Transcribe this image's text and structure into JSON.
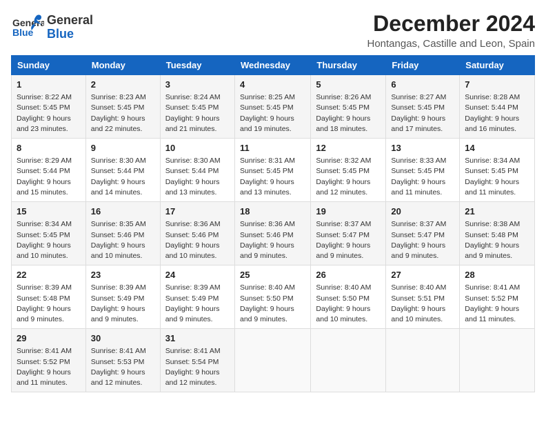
{
  "header": {
    "logo_line1": "General",
    "logo_line2": "Blue",
    "title": "December 2024",
    "subtitle": "Hontangas, Castille and Leon, Spain"
  },
  "days_of_week": [
    "Sunday",
    "Monday",
    "Tuesday",
    "Wednesday",
    "Thursday",
    "Friday",
    "Saturday"
  ],
  "weeks": [
    [
      {
        "day": "1",
        "info": "Sunrise: 8:22 AM\nSunset: 5:45 PM\nDaylight: 9 hours\nand 23 minutes."
      },
      {
        "day": "2",
        "info": "Sunrise: 8:23 AM\nSunset: 5:45 PM\nDaylight: 9 hours\nand 22 minutes."
      },
      {
        "day": "3",
        "info": "Sunrise: 8:24 AM\nSunset: 5:45 PM\nDaylight: 9 hours\nand 21 minutes."
      },
      {
        "day": "4",
        "info": "Sunrise: 8:25 AM\nSunset: 5:45 PM\nDaylight: 9 hours\nand 19 minutes."
      },
      {
        "day": "5",
        "info": "Sunrise: 8:26 AM\nSunset: 5:45 PM\nDaylight: 9 hours\nand 18 minutes."
      },
      {
        "day": "6",
        "info": "Sunrise: 8:27 AM\nSunset: 5:45 PM\nDaylight: 9 hours\nand 17 minutes."
      },
      {
        "day": "7",
        "info": "Sunrise: 8:28 AM\nSunset: 5:44 PM\nDaylight: 9 hours\nand 16 minutes."
      }
    ],
    [
      {
        "day": "8",
        "info": "Sunrise: 8:29 AM\nSunset: 5:44 PM\nDaylight: 9 hours\nand 15 minutes."
      },
      {
        "day": "9",
        "info": "Sunrise: 8:30 AM\nSunset: 5:44 PM\nDaylight: 9 hours\nand 14 minutes."
      },
      {
        "day": "10",
        "info": "Sunrise: 8:30 AM\nSunset: 5:44 PM\nDaylight: 9 hours\nand 13 minutes."
      },
      {
        "day": "11",
        "info": "Sunrise: 8:31 AM\nSunset: 5:45 PM\nDaylight: 9 hours\nand 13 minutes."
      },
      {
        "day": "12",
        "info": "Sunrise: 8:32 AM\nSunset: 5:45 PM\nDaylight: 9 hours\nand 12 minutes."
      },
      {
        "day": "13",
        "info": "Sunrise: 8:33 AM\nSunset: 5:45 PM\nDaylight: 9 hours\nand 11 minutes."
      },
      {
        "day": "14",
        "info": "Sunrise: 8:34 AM\nSunset: 5:45 PM\nDaylight: 9 hours\nand 11 minutes."
      }
    ],
    [
      {
        "day": "15",
        "info": "Sunrise: 8:34 AM\nSunset: 5:45 PM\nDaylight: 9 hours\nand 10 minutes."
      },
      {
        "day": "16",
        "info": "Sunrise: 8:35 AM\nSunset: 5:46 PM\nDaylight: 9 hours\nand 10 minutes."
      },
      {
        "day": "17",
        "info": "Sunrise: 8:36 AM\nSunset: 5:46 PM\nDaylight: 9 hours\nand 10 minutes."
      },
      {
        "day": "18",
        "info": "Sunrise: 8:36 AM\nSunset: 5:46 PM\nDaylight: 9 hours\nand 9 minutes."
      },
      {
        "day": "19",
        "info": "Sunrise: 8:37 AM\nSunset: 5:47 PM\nDaylight: 9 hours\nand 9 minutes."
      },
      {
        "day": "20",
        "info": "Sunrise: 8:37 AM\nSunset: 5:47 PM\nDaylight: 9 hours\nand 9 minutes."
      },
      {
        "day": "21",
        "info": "Sunrise: 8:38 AM\nSunset: 5:48 PM\nDaylight: 9 hours\nand 9 minutes."
      }
    ],
    [
      {
        "day": "22",
        "info": "Sunrise: 8:39 AM\nSunset: 5:48 PM\nDaylight: 9 hours\nand 9 minutes."
      },
      {
        "day": "23",
        "info": "Sunrise: 8:39 AM\nSunset: 5:49 PM\nDaylight: 9 hours\nand 9 minutes."
      },
      {
        "day": "24",
        "info": "Sunrise: 8:39 AM\nSunset: 5:49 PM\nDaylight: 9 hours\nand 9 minutes."
      },
      {
        "day": "25",
        "info": "Sunrise: 8:40 AM\nSunset: 5:50 PM\nDaylight: 9 hours\nand 9 minutes."
      },
      {
        "day": "26",
        "info": "Sunrise: 8:40 AM\nSunset: 5:50 PM\nDaylight: 9 hours\nand 10 minutes."
      },
      {
        "day": "27",
        "info": "Sunrise: 8:40 AM\nSunset: 5:51 PM\nDaylight: 9 hours\nand 10 minutes."
      },
      {
        "day": "28",
        "info": "Sunrise: 8:41 AM\nSunset: 5:52 PM\nDaylight: 9 hours\nand 11 minutes."
      }
    ],
    [
      {
        "day": "29",
        "info": "Sunrise: 8:41 AM\nSunset: 5:52 PM\nDaylight: 9 hours\nand 11 minutes."
      },
      {
        "day": "30",
        "info": "Sunrise: 8:41 AM\nSunset: 5:53 PM\nDaylight: 9 hours\nand 12 minutes."
      },
      {
        "day": "31",
        "info": "Sunrise: 8:41 AM\nSunset: 5:54 PM\nDaylight: 9 hours\nand 12 minutes."
      },
      {
        "day": "",
        "info": ""
      },
      {
        "day": "",
        "info": ""
      },
      {
        "day": "",
        "info": ""
      },
      {
        "day": "",
        "info": ""
      }
    ]
  ]
}
